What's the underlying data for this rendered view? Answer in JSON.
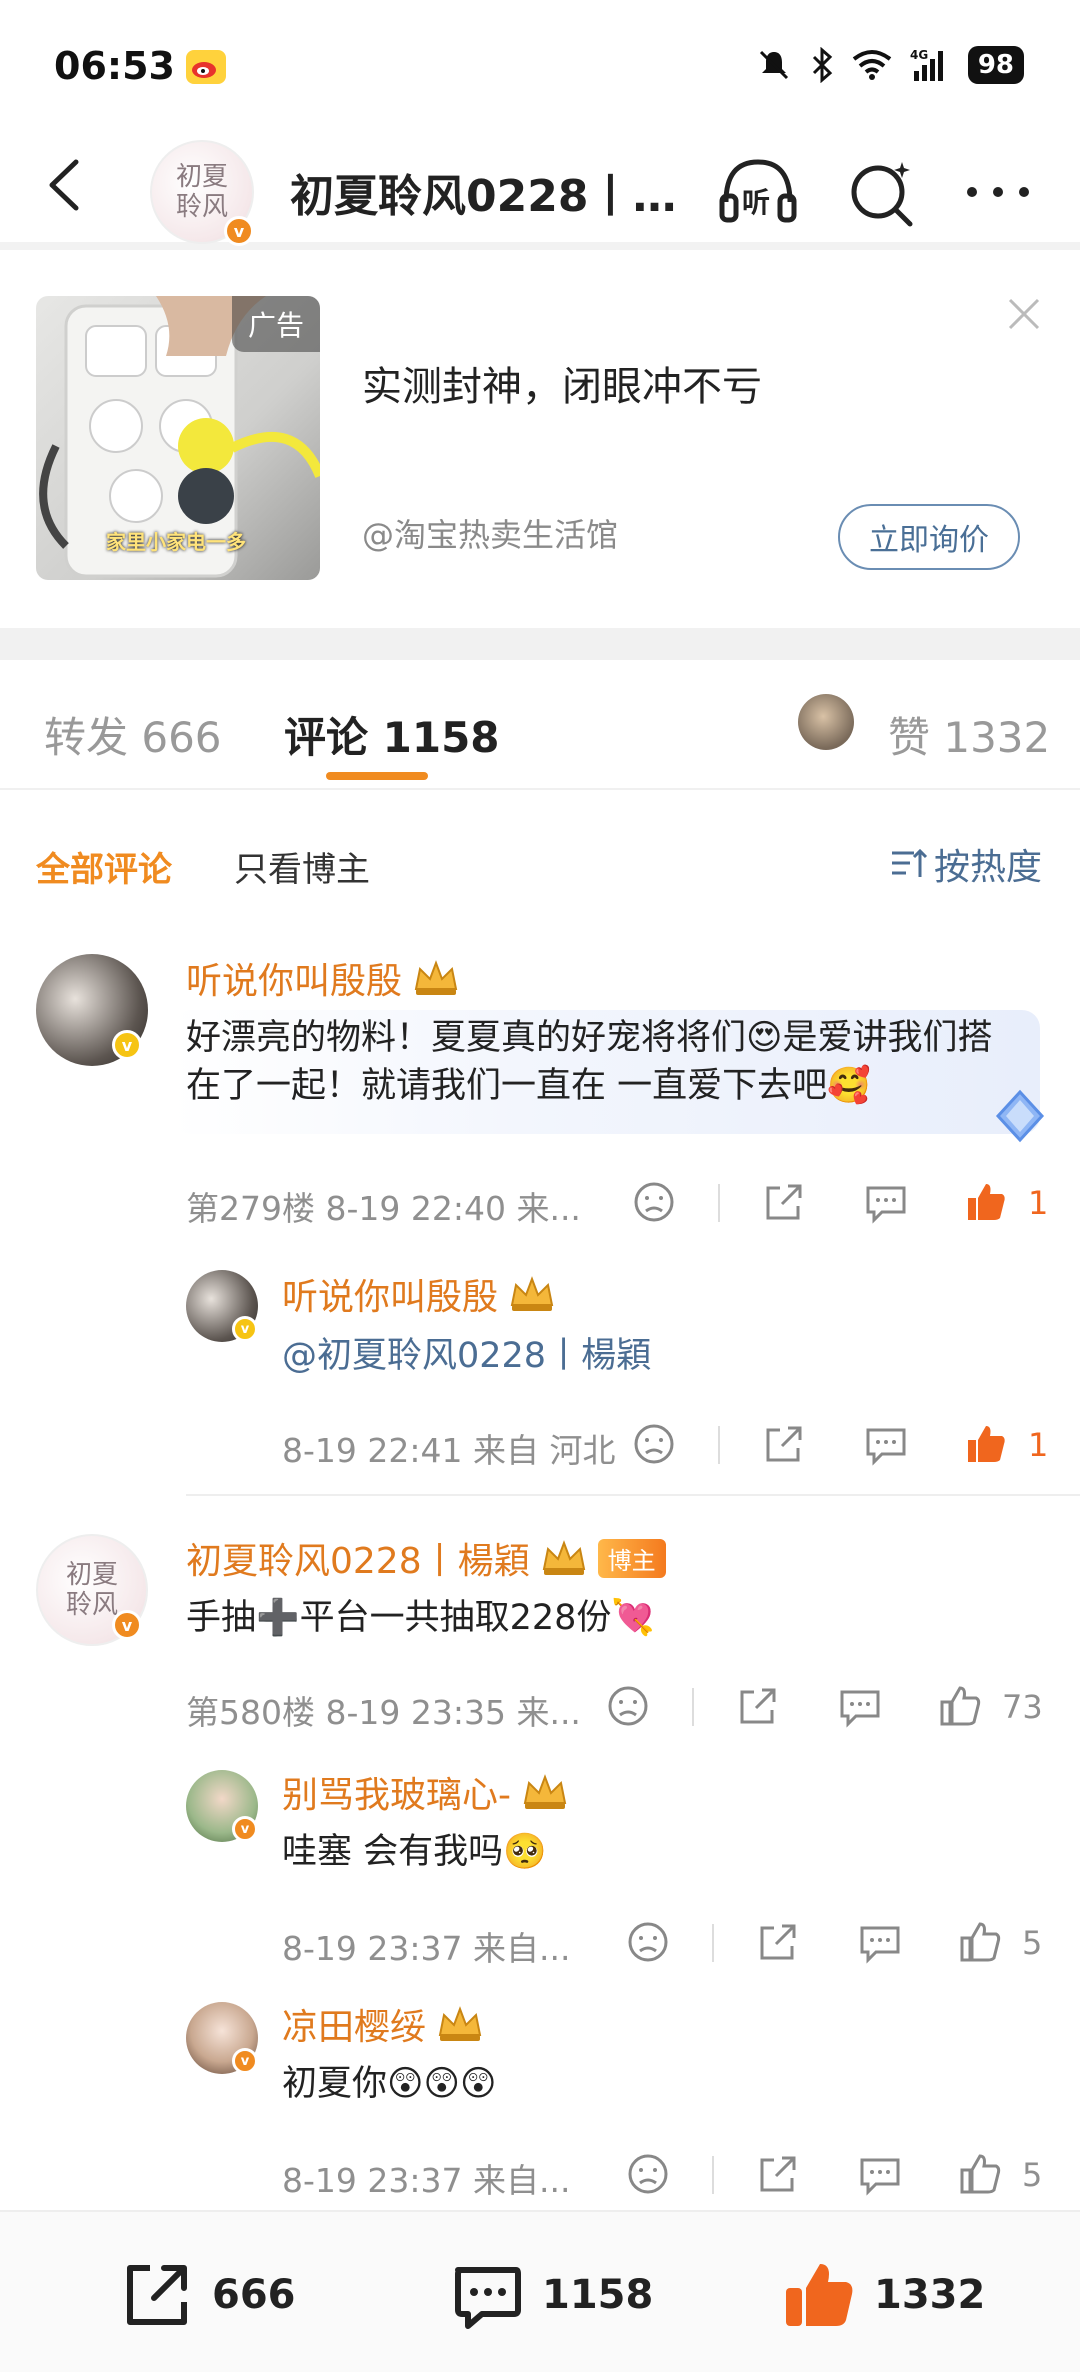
{
  "status": {
    "time": "06:53",
    "battery": "98"
  },
  "header": {
    "title": "初夏聆风0228丨…",
    "avatar_text": "初夏聆风"
  },
  "ad": {
    "tag": "广告",
    "image_caption": "家里小家电一多",
    "title": "实测封神，闭眼冲不亏",
    "source": "@淘宝热卖生活馆",
    "button": "立即询价"
  },
  "tabs": [
    {
      "label": "转发 666"
    },
    {
      "label": "评论 1158"
    },
    {
      "label": "赞 1332"
    }
  ],
  "filter": {
    "all": "全部评论",
    "blogger_only": "只看博主",
    "sort": "按热度"
  },
  "comments": [
    {
      "name": "听说你叫殷殷",
      "text": "好漂亮的物料！夏夏真的好宠将将们😍是爱讲我们搭在了一起！就请我们一直在 一直爱下去吧🥰",
      "meta": "第279楼  8-19 22:40  来...",
      "likes": "1"
    },
    {
      "name": "听说你叫殷殷",
      "text": "@初夏聆风0228丨楊穎",
      "meta": "8-19 22:41  来自 河北",
      "likes": "1"
    },
    {
      "name": "初夏聆风0228丨楊穎",
      "tag": "博主",
      "avatar_text": "初夏聆风",
      "text": "手抽➕平台一共抽取228份💘",
      "meta": "第580楼  8-19 23:35  来...",
      "likes": "73"
    },
    {
      "name": "别骂我玻璃心-",
      "text": "哇塞 会有我吗🥺",
      "meta": "8-19 23:37  来自...",
      "likes": "5"
    },
    {
      "name": "凉田樱绥",
      "text": "初夏你😲😲😲",
      "meta": "8-19 23:37  来自...",
      "likes": "5"
    }
  ],
  "bottom": {
    "repost": "666",
    "comment": "1158",
    "like": "1332"
  },
  "colors": {
    "accent": "#f08b20",
    "link": "#4b6d93",
    "like": "#f0661e"
  }
}
